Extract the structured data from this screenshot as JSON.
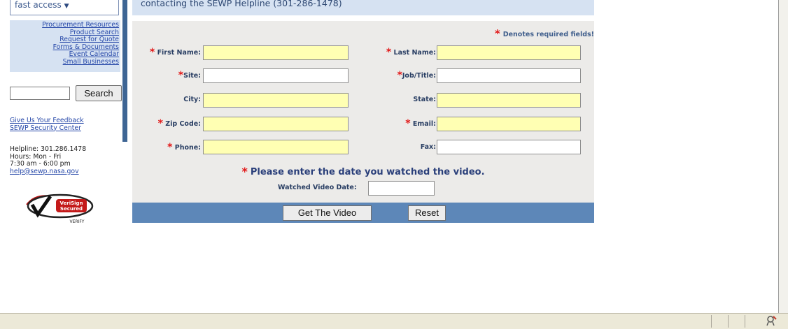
{
  "sidebar": {
    "quick_access_label": "fast access",
    "menu_items": [
      {
        "label": "Procurement Resources"
      },
      {
        "label": "Product Search"
      },
      {
        "label": "Request for Quote"
      },
      {
        "label": "Forms & Documents"
      },
      {
        "label": "Event Calendar"
      },
      {
        "label": "Small Businesses"
      }
    ],
    "search_input_value": "",
    "search_button_label": "Search",
    "links": [
      {
        "label": "Give Us Your Feedback"
      },
      {
        "label": "SEWP Security Center"
      }
    ],
    "helpline": {
      "phone": "Helpline: 301.286.1478",
      "hours_days": "Hours: Mon - Fri",
      "hours_time": "7:30 am - 6:00 pm",
      "email": "help@sewp.nasa.gov"
    },
    "verisign": {
      "line1": "VeriSign",
      "line2": "Secured",
      "verify": "VERIFY"
    }
  },
  "banner_text": "contacting the SEWP Helpline (301-286-1478)",
  "form": {
    "required_note": "Denotes required fields!",
    "star": "*",
    "fields": {
      "first_name": {
        "label": "First Name:",
        "value": ""
      },
      "last_name": {
        "label": "Last Name:",
        "value": ""
      },
      "site": {
        "label": "Site:",
        "value": ""
      },
      "job_title": {
        "label": "Job/Title:",
        "value": ""
      },
      "city": {
        "label": "City:",
        "value": ""
      },
      "state": {
        "label": "State:",
        "value": ""
      },
      "zip": {
        "label": "Zip Code:",
        "value": ""
      },
      "email": {
        "label": "Email:",
        "value": ""
      },
      "phone": {
        "label": "Phone:",
        "value": ""
      },
      "fax": {
        "label": "Fax:",
        "value": ""
      }
    },
    "video_prompt": "Please enter the date you watched the video.",
    "watched_date": {
      "label": "Watched Video Date:",
      "value": ""
    },
    "get_video_button": "Get The Video",
    "reset_button": "Reset"
  },
  "colors": {
    "required_field_bg": "#ffffb3",
    "accent_blue": "#5d87b8",
    "required_star": "#e21a1a"
  },
  "status_bar": {
    "icon": "connection-icon"
  }
}
